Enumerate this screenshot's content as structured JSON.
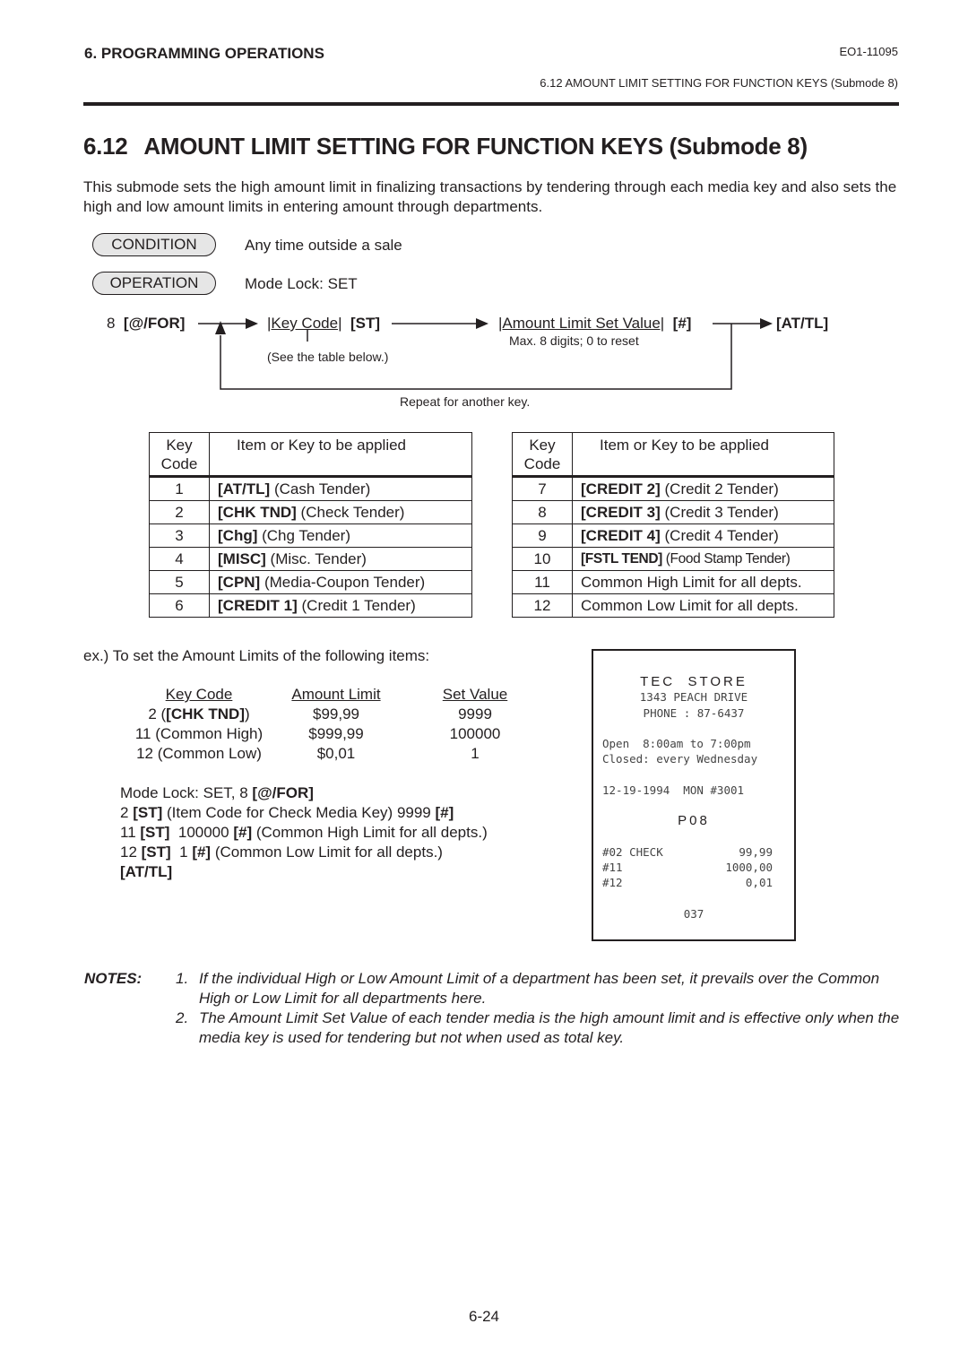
{
  "header": {
    "chapter": "6.  PROGRAMMING OPERATIONS",
    "doc_id": "EO1-11095",
    "section_ref": "6.12  AMOUNT LIMIT SETTING FOR FUNCTION KEYS (Submode 8)"
  },
  "section": {
    "number": "6.12",
    "title": "AMOUNT LIMIT SETTING FOR FUNCTION KEYS (Submode 8)",
    "intro": "This submode sets the high amount limit in finalizing transactions by tendering through each media key and also sets the high and low amount limits in entering amount through departments."
  },
  "condition": {
    "label": "CONDITION",
    "text": "Any time outside a sale"
  },
  "operation": {
    "label": "OPERATION",
    "text": "Mode Lock:  SET"
  },
  "flow": {
    "start_num": "8",
    "start_key": "[@/FOR]",
    "key_code": "|Key Code|",
    "st_key": "[ST]",
    "see_table": "(See the table below.)",
    "amount": "|Amount Limit Set Value|",
    "hash_key": "[#]",
    "amount_note": "Max. 8 digits;  0 to reset",
    "end_key": "[AT/TL]",
    "repeat": "Repeat for another key."
  },
  "key_table": {
    "headers": {
      "code": "Key Code",
      "item": "Item or Key to be applied"
    },
    "left": [
      {
        "code": "1",
        "key": "[AT/TL]",
        "desc": " (Cash Tender)"
      },
      {
        "code": "2",
        "key": "[CHK TND]",
        "desc": " (Check Tender)"
      },
      {
        "code": "3",
        "key": "[Chg]",
        "desc": " (Chg Tender)"
      },
      {
        "code": "4",
        "key": "[MISC]",
        "desc": " (Misc. Tender)"
      },
      {
        "code": "5",
        "key": "[CPN]",
        "desc": " (Media-Coupon Tender)"
      },
      {
        "code": "6",
        "key": "[CREDIT 1]",
        "desc": " (Credit 1 Tender)"
      }
    ],
    "right": [
      {
        "code": "7",
        "key": "[CREDIT 2]",
        "desc": " (Credit 2 Tender)"
      },
      {
        "code": "8",
        "key": "[CREDIT 3]",
        "desc": " (Credit 3 Tender)"
      },
      {
        "code": "9",
        "key": "[CREDIT 4]",
        "desc": " (Credit 4 Tender)"
      },
      {
        "code": "10",
        "key": "[FSTL TEND]",
        "desc": " (Food Stamp Tender)"
      },
      {
        "code": "11",
        "key": "",
        "desc": "Common High Limit for all depts."
      },
      {
        "code": "12",
        "key": "",
        "desc": "Common Low Limit for all depts."
      }
    ]
  },
  "example": {
    "intro": "ex.)  To set the Amount Limits of the following items:",
    "headers": {
      "code": "Key Code",
      "limit": "Amount Limit",
      "value": "Set Value"
    },
    "rows": [
      {
        "code_pre": "2 (",
        "code_key": "[CHK TND]",
        "code_post": ")",
        "limit": "$99,99",
        "value": "9999"
      },
      {
        "code_pre": "11 (Common High)",
        "code_key": "",
        "code_post": "",
        "limit": "$999,99",
        "value": "100000"
      },
      {
        "code_pre": "12 (Common Low)",
        "code_key": "",
        "code_post": "",
        "limit": "$0,01",
        "value": "1"
      }
    ],
    "steps": {
      "s1_text": "Mode Lock:  SET, 8 ",
      "s1_key": "[@/FOR]",
      "s2_num": "2 ",
      "s2_key1": "[ST]",
      "s2_text": " (Item Code for Check Media Key)  9999 ",
      "s2_key2": "[#]",
      "s3_num": "11 ",
      "s3_key1": "[ST]",
      "s3_text1": "  100000 ",
      "s3_key2": "[#]",
      "s3_text2": " (Common High Limit for all depts.)",
      "s4_num": "12 ",
      "s4_key1": "[ST]",
      "s4_text1": "  1 ",
      "s4_key2": "[#]",
      "s4_text2": " (Common Low Limit for all depts.)",
      "s5_key": "[AT/TL]"
    }
  },
  "receipt": {
    "store": "TEC  STORE",
    "address": "1343 PEACH DRIVE",
    "phone": "PHONE : 87-6437",
    "hours": "Open  8:00am to 7:00pm",
    "closed": "Closed: every Wednesday",
    "date_line": "12-19-1994  MON #3001",
    "mode": "P08",
    "lines": [
      {
        "label": "#02 CHECK",
        "value": "99,99"
      },
      {
        "label": "#11",
        "value": "1000,00"
      },
      {
        "label": "#12",
        "value": "0,01"
      }
    ],
    "consecutive": "037"
  },
  "notes": {
    "label": "NOTES:",
    "items": [
      {
        "num": "1.",
        "text": "If the individual High or Low Amount Limit of a department has been set, it prevails over the Common High or Low Limit for all departments here."
      },
      {
        "num": "2.",
        "text": "The Amount Limit Set Value of each tender media is the high amount limit and is effective only when the media key is used for tendering but not when used as total key."
      }
    ]
  },
  "page_number": "6-24"
}
